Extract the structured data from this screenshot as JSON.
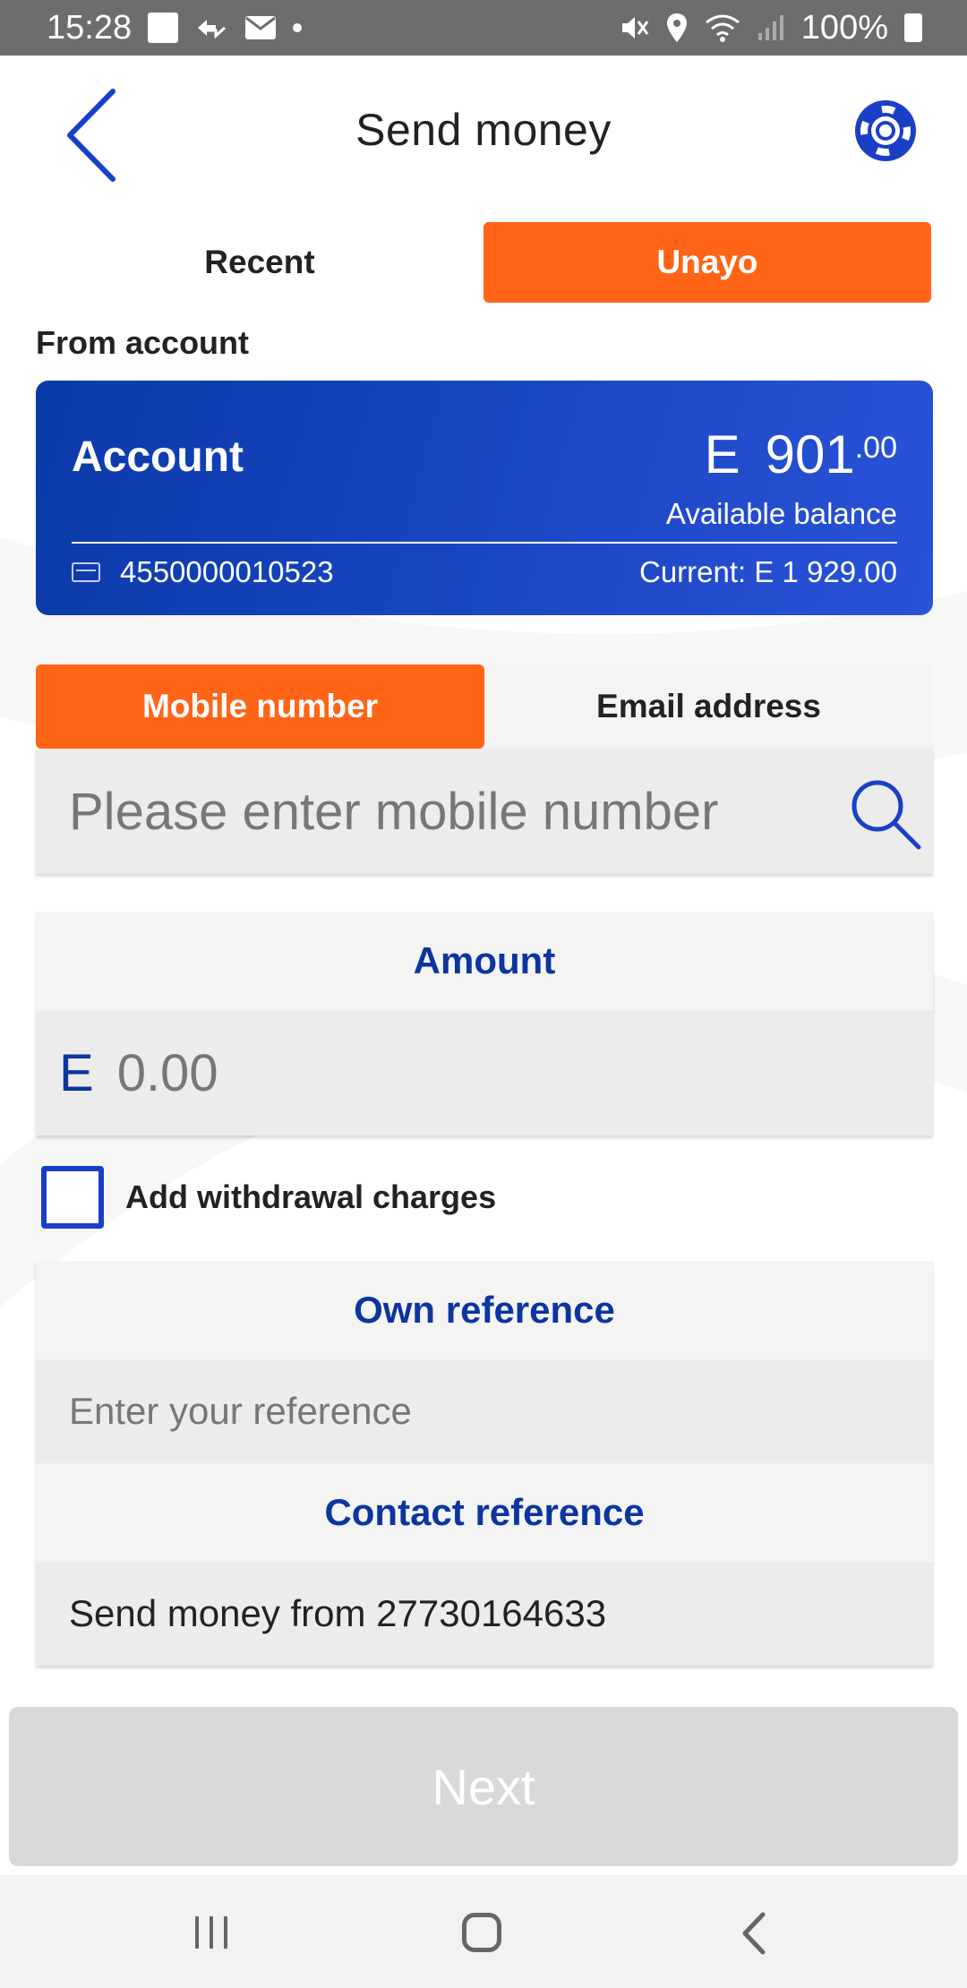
{
  "status_bar": {
    "time": "15:28",
    "battery": "100%"
  },
  "header": {
    "title": "Send money"
  },
  "top_tabs": [
    {
      "label": "Recent",
      "active": false
    },
    {
      "label": "Unayo",
      "active": true
    }
  ],
  "from_account": {
    "label": "From account",
    "name": "Account",
    "currency": "E",
    "balance_whole": "901",
    "balance_cents": ".00",
    "available_label": "Available balance",
    "number": "4550000010523",
    "current": "Current: E 1 929.00"
  },
  "recipient_tabs": [
    {
      "label": "Mobile number",
      "active": true
    },
    {
      "label": "Email address",
      "active": false
    }
  ],
  "mobile": {
    "placeholder": "Please enter mobile number",
    "value": ""
  },
  "amount": {
    "label": "Amount",
    "currency": "E",
    "placeholder": "0.00"
  },
  "charges": {
    "label": "Add withdrawal charges",
    "checked": false
  },
  "own_reference": {
    "label": "Own reference",
    "placeholder": "Enter your reference"
  },
  "contact_reference": {
    "label": "Contact reference",
    "value": "Send money from 27730164633"
  },
  "next": {
    "label": "Next"
  },
  "colors": {
    "accent": "#ff6417",
    "primary": "#0b35a0",
    "card_gradient_start": "#0a3aa8",
    "card_gradient_end": "#2a52d8",
    "disabled": "#d9d9d9"
  }
}
